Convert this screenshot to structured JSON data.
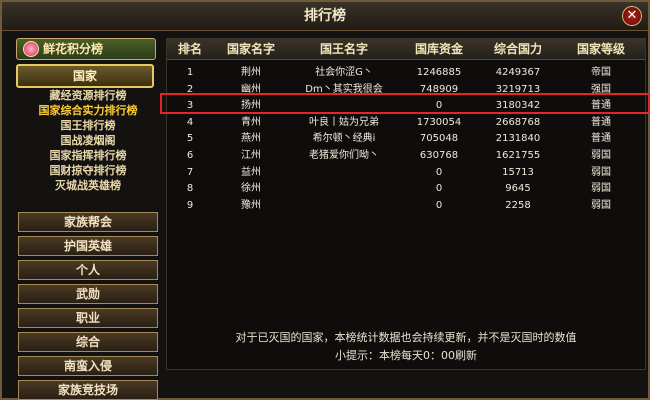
{
  "window": {
    "title": "排行榜",
    "close_glyph": "✕"
  },
  "left_menu": {
    "flower_ranking": "鲜花积分榜",
    "nation_tab": "国家",
    "sub_items": [
      {
        "label": "藏经资源排行榜",
        "active": false
      },
      {
        "label": "国家综合实力排行榜",
        "active": true
      },
      {
        "label": "国王排行榜",
        "active": false
      },
      {
        "label": "国战凌烟阁",
        "active": false
      },
      {
        "label": "国家指挥排行榜",
        "active": false
      },
      {
        "label": "国财掠夺排行榜",
        "active": false
      },
      {
        "label": "灭城战英雄榜",
        "active": false
      }
    ],
    "categories": [
      "家族帮会",
      "护国英雄",
      "个人",
      "武勋",
      "职业",
      "综合",
      "南蛮入侵",
      "家族竞技场"
    ]
  },
  "table": {
    "headers": [
      "排名",
      "国家名字",
      "国王名字",
      "国库资金",
      "综合国力",
      "国家等级"
    ],
    "rows": [
      {
        "rank": "1",
        "nation": "荆州",
        "king": "社会你涩G丶",
        "treasury": "1246885",
        "power": "4249367",
        "level": "帝国"
      },
      {
        "rank": "2",
        "nation": "幽州",
        "king": "Dm丶其实我很会",
        "treasury": "748909",
        "power": "3219713",
        "level": "强国"
      },
      {
        "rank": "3",
        "nation": "扬州",
        "king": "",
        "treasury": "0",
        "power": "3180342",
        "level": "普通"
      },
      {
        "rank": "4",
        "nation": "青州",
        "king": "叶良丨姑为兄弟",
        "treasury": "1730054",
        "power": "2668768",
        "level": "普通"
      },
      {
        "rank": "5",
        "nation": "燕州",
        "king": "希尔顿丶经典i",
        "treasury": "705048",
        "power": "2131840",
        "level": "普通"
      },
      {
        "rank": "6",
        "nation": "江州",
        "king": "老猪爱你们呦丶",
        "treasury": "630768",
        "power": "1621755",
        "level": "弱国"
      },
      {
        "rank": "7",
        "nation": "益州",
        "king": "",
        "treasury": "0",
        "power": "15713",
        "level": "弱国"
      },
      {
        "rank": "8",
        "nation": "徐州",
        "king": "",
        "treasury": "0",
        "power": "9645",
        "level": "弱国"
      },
      {
        "rank": "9",
        "nation": "豫州",
        "king": "",
        "treasury": "0",
        "power": "2258",
        "level": "弱国"
      }
    ],
    "highlighted_rank": "3"
  },
  "notice": {
    "line1": "对于已灭国的国家，本榜统计数据也会持续更新，并不是灭国时的数值",
    "line2": "小提示：本榜每天0：00刷新"
  },
  "colors": {
    "highlight_border": "#e0282a",
    "active_sub": "#ffcc33"
  }
}
